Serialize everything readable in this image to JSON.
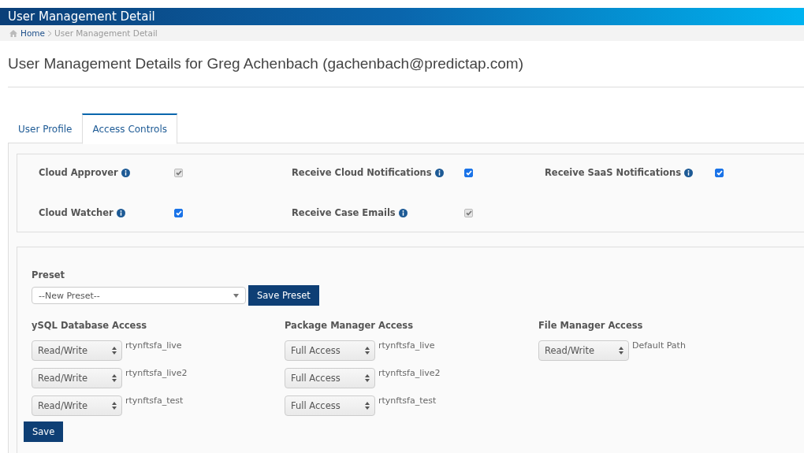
{
  "header": {
    "title": "User Management Detail"
  },
  "breadcrumb": [
    {
      "label": "Home",
      "link": true
    },
    {
      "label": "User Management Detail",
      "link": false
    }
  ],
  "page_title": "User Management Details for Greg Achenbach (gachenbach@predictap.com)",
  "tabs": [
    {
      "label": "User Profile",
      "selected": false
    },
    {
      "label": "Access Controls",
      "selected": true
    }
  ],
  "permissions": [
    {
      "label": "Cloud Approver",
      "checked": true,
      "disabled": true
    },
    {
      "label": "Receive Cloud Notifications",
      "checked": true,
      "disabled": false
    },
    {
      "label": "Receive SaaS Notifications",
      "checked": true,
      "disabled": false
    },
    {
      "label": "Cloud Watcher",
      "checked": true,
      "disabled": false
    },
    {
      "label": "Receive Case Emails",
      "checked": true,
      "disabled": true
    }
  ],
  "preset": {
    "label": "Preset",
    "value": "--New Preset--",
    "button": "Save Preset"
  },
  "access_groups": [
    {
      "title": "ySQL Database Access",
      "rows": [
        {
          "value": "Read/Write",
          "name": "rtynftsfa_live"
        },
        {
          "value": "Read/Write",
          "name": "rtynftsfa_live2"
        },
        {
          "value": "Read/Write",
          "name": "rtynftsfa_test"
        }
      ]
    },
    {
      "title": "Package Manager Access",
      "rows": [
        {
          "value": "Full Access",
          "name": "rtynftsfa_live"
        },
        {
          "value": "Full Access",
          "name": "rtynftsfa_live2"
        },
        {
          "value": "Full Access",
          "name": "rtynftsfa_test"
        }
      ]
    },
    {
      "title": "File Manager Access",
      "rows": [
        {
          "value": "Read/Write",
          "name": "Default Path"
        }
      ]
    }
  ],
  "save_button": "Save"
}
